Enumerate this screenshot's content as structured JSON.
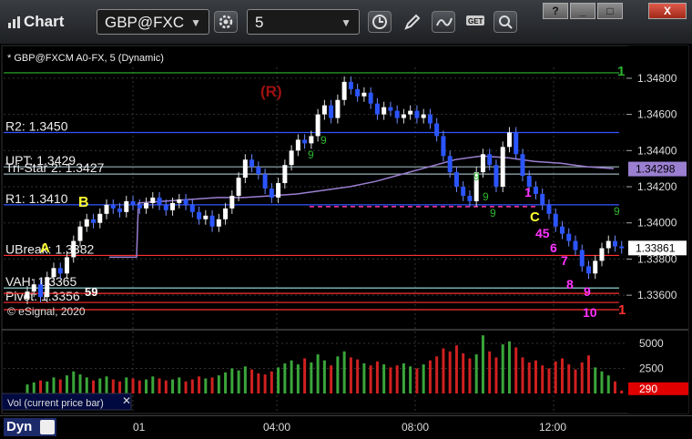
{
  "toolbar": {
    "app_title": "Chart",
    "symbol": "GBP@FXC",
    "interval": "5",
    "icons": [
      "gear-icon",
      "clock-icon",
      "pencil-icon",
      "study-icon",
      "get-icon",
      "search-icon"
    ]
  },
  "window_buttons": [
    "?",
    "_",
    "□",
    "X"
  ],
  "chart_header": "* GBP@FXCM A0-FX, 5 (Dynamic)",
  "copyright": "© eSignal, 2020",
  "bottom": {
    "mode": "Dyn",
    "time_labels": [
      "01",
      "04:00",
      "08:00",
      "12:00"
    ]
  },
  "colors": {
    "up": "#ffffff",
    "down": "#2b55ff",
    "vwap": "#9b7fd1",
    "bg": "#000000"
  },
  "chart_data": [
    {
      "type": "candlestick",
      "title": "GBP@FXCM A0-FX, 5 (Dynamic)",
      "ylim": [
        1.3352,
        1.3486
      ],
      "y_ticks": [
        "1.34800",
        "1.34600",
        "1.34400",
        "1.34200",
        "1.34000",
        "1.33800",
        "1.33600"
      ],
      "y_tick_values": [
        1.348,
        1.346,
        1.344,
        1.342,
        1.34,
        1.338,
        1.336
      ],
      "x_ticks": [
        "01",
        "04:00",
        "08:00",
        "12:00"
      ],
      "last_price_label": "1.33861",
      "vwap_label": "1.34298",
      "levels": [
        {
          "label": "R2: 1.3450",
          "value": 1.345,
          "color": "#3355ff"
        },
        {
          "label": "UPT: 1.3429",
          "value": 1.3431,
          "color": "#9ab0b8"
        },
        {
          "label": "Tri-Star 2: 1.3427",
          "value": 1.3427,
          "color": "#9ab0b8"
        },
        {
          "label": "R1: 1.3410",
          "value": 1.341,
          "color": "#3355ff"
        },
        {
          "label": "UBreak: 1.3382",
          "value": 1.3382,
          "color": "#ff3030"
        },
        {
          "label": "VAH: 1.3365",
          "value": 1.3364,
          "color": "#9ee8e8"
        },
        {
          "label": "Pivot: 1.3356",
          "value": 1.3356,
          "color": "#ff3030"
        },
        {
          "label": "",
          "value": 1.3483,
          "color": "#2db52d"
        },
        {
          "label": "",
          "value": 1.3361,
          "color": "#ff3030"
        },
        {
          "label": "",
          "value": 1.3352,
          "color": "#ff3030"
        }
      ],
      "annotations": [
        {
          "text": "(R)",
          "color": "#a01010"
        },
        {
          "text": "B",
          "color": "#ffff33"
        },
        {
          "text": "A",
          "color": "#ffff33"
        },
        {
          "text": "C",
          "color": "#ffff33"
        },
        {
          "text": "1",
          "color": "#ff33ff"
        },
        {
          "text": "45",
          "color": "#ff33ff"
        },
        {
          "text": "6",
          "color": "#ff33ff"
        },
        {
          "text": "7",
          "color": "#ff33ff"
        },
        {
          "text": "8",
          "color": "#ff33ff"
        },
        {
          "text": "9",
          "color": "#ff33ff"
        },
        {
          "text": "10",
          "color": "#ff33ff"
        },
        {
          "text": "1",
          "color": "#2db52d"
        },
        {
          "text": "1",
          "color": "#ff3030"
        },
        {
          "text": "59",
          "color": "#ffffff"
        }
      ],
      "close": [
        1.3362,
        1.3366,
        1.3359,
        1.337,
        1.3375,
        1.3372,
        1.3381,
        1.339,
        1.3398,
        1.3402,
        1.34,
        1.3405,
        1.341,
        1.3408,
        1.3406,
        1.3412,
        1.341,
        1.3408,
        1.3411,
        1.3414,
        1.341,
        1.3407,
        1.3411,
        1.3413,
        1.341,
        1.3406,
        1.3402,
        1.3404,
        1.3398,
        1.3402,
        1.3408,
        1.3415,
        1.3425,
        1.3435,
        1.3431,
        1.3427,
        1.3419,
        1.3414,
        1.3422,
        1.3432,
        1.344,
        1.3446,
        1.3444,
        1.3448,
        1.346,
        1.3465,
        1.3458,
        1.3468,
        1.3478,
        1.3474,
        1.347,
        1.3472,
        1.3466,
        1.346,
        1.3464,
        1.3462,
        1.3458,
        1.346,
        1.3462,
        1.3458,
        1.346,
        1.3455,
        1.3448,
        1.3437,
        1.3428,
        1.342,
        1.3415,
        1.3412,
        1.3428,
        1.3438,
        1.3432,
        1.342,
        1.3442,
        1.345,
        1.3438,
        1.3426,
        1.342,
        1.3416,
        1.341,
        1.3405,
        1.3398,
        1.3394,
        1.339,
        1.3385,
        1.3376,
        1.3372,
        1.3379,
        1.3386,
        1.339,
        1.3387,
        1.3386
      ],
      "volume": {
        "label": "Vol (current price bar)",
        "ylim": [
          0,
          6000
        ],
        "y_ticks": [
          "5000",
          "2500"
        ],
        "current": "290",
        "values": [
          900,
          1100,
          1300,
          1200,
          1600,
          1400,
          1800,
          2200,
          1900,
          1600,
          1300,
          1500,
          1700,
          1400,
          1200,
          1600,
          1500,
          1300,
          1400,
          1700,
          1500,
          1300,
          1400,
          1600,
          1200,
          1400,
          1700,
          1500,
          1600,
          1800,
          2100,
          2500,
          2300,
          2700,
          2400,
          2000,
          1900,
          2200,
          2600,
          3000,
          3300,
          2900,
          3500,
          3100,
          3900,
          3300,
          2800,
          3700,
          4200,
          3600,
          3400,
          3000,
          2800,
          3200,
          2900,
          2600,
          2800,
          3000,
          2700,
          2500,
          2900,
          3300,
          3700,
          4500,
          4200,
          4800,
          4000,
          3500,
          3900,
          5800,
          4200,
          3600,
          4900,
          5200,
          4600,
          3600,
          3100,
          3300,
          2800,
          2500,
          3200,
          3500,
          2900,
          2400,
          3100,
          3800,
          2600,
          2200,
          1800,
          1200,
          290
        ]
      }
    }
  ]
}
